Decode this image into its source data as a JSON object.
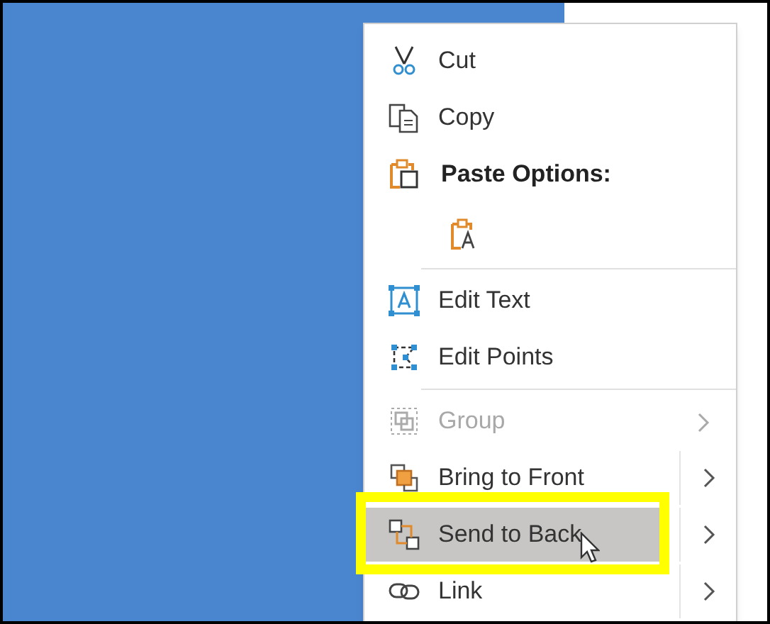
{
  "menu": {
    "items": [
      {
        "kind": "command",
        "label": "Cut",
        "disabled": false,
        "selected": false,
        "has_submenu": false,
        "split": false,
        "annotated": false
      },
      {
        "kind": "command",
        "label": "Copy",
        "disabled": false,
        "selected": false,
        "has_submenu": false,
        "split": false,
        "annotated": false
      },
      {
        "kind": "header",
        "label": "Paste Options:"
      },
      {
        "kind": "paste_option"
      },
      {
        "kind": "separator"
      },
      {
        "kind": "command",
        "label": "Edit Text",
        "disabled": false,
        "selected": false,
        "has_submenu": false,
        "split": false,
        "annotated": false
      },
      {
        "kind": "command",
        "label": "Edit Points",
        "disabled": false,
        "selected": false,
        "has_submenu": false,
        "split": false,
        "annotated": false
      },
      {
        "kind": "separator"
      },
      {
        "kind": "command",
        "label": "Group",
        "disabled": true,
        "selected": false,
        "has_submenu": true,
        "split": false,
        "annotated": false
      },
      {
        "kind": "command",
        "label": "Bring to Front",
        "disabled": false,
        "selected": false,
        "has_submenu": true,
        "split": true,
        "annotated": false
      },
      {
        "kind": "command",
        "label": "Send to Back",
        "disabled": false,
        "selected": true,
        "has_submenu": true,
        "split": true,
        "annotated": true
      },
      {
        "kind": "command",
        "label": "Link",
        "disabled": false,
        "selected": false,
        "has_submenu": true,
        "split": true,
        "annotated": false
      }
    ]
  }
}
